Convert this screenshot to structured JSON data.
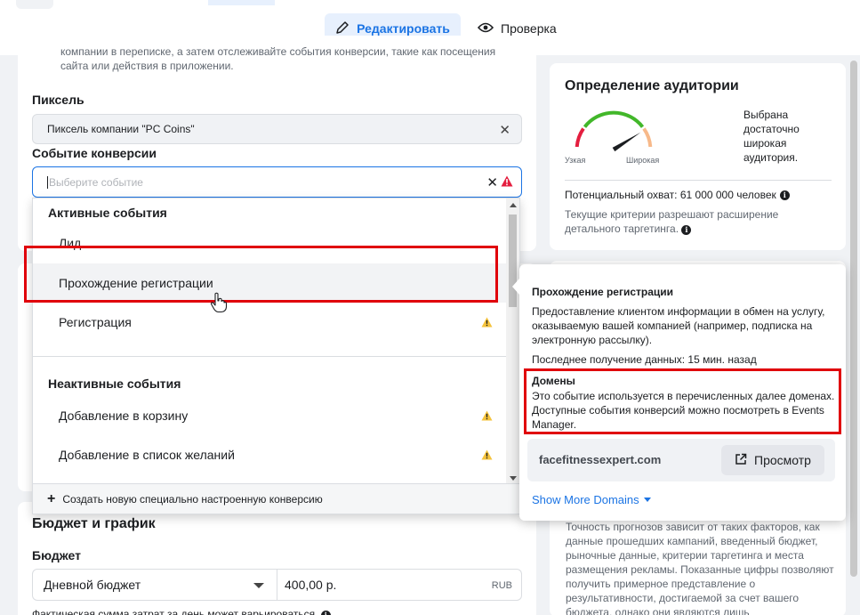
{
  "tabs": {
    "edit_label": "Редактировать",
    "review_label": "Проверка"
  },
  "conversion": {
    "intro_text": "компании в переписке, а затем отслеживайте события конверсии, такие как посещения сайта или действия в приложении.",
    "pixel_label": "Пиксель",
    "pixel_value": "Пиксель компании \"PC Coins\"",
    "event_label": "Событие конверсии",
    "event_placeholder": "Выберите событие"
  },
  "dropdown": {
    "active_header": "Активные события",
    "active_items": [
      {
        "label": "Лид",
        "warning": false
      },
      {
        "label": "Прохождение регистрации",
        "warning": false,
        "highlighted": true
      },
      {
        "label": "Регистрация",
        "warning": true
      }
    ],
    "inactive_header": "Неактивные события",
    "inactive_items": [
      {
        "label": "Добавление в корзину",
        "warning": true
      },
      {
        "label": "Добавление в список желаний",
        "warning": true
      }
    ],
    "footer_label": "Создать новую специально настроенную конверсию"
  },
  "budget": {
    "title": "Бюджет и график",
    "label": "Бюджет",
    "type_value": "Дневной бюджет",
    "amount_value": "400,00 р.",
    "currency": "RUB",
    "note": "Фактическая сумма затрат за день может варьироваться."
  },
  "audience": {
    "title": "Определение аудитории",
    "gauge_low": "Узкая",
    "gauge_high": "Широкая",
    "gauge_level": 0.82,
    "description": "Выбрана достаточно широкая аудитория.",
    "reach": "Потенциальный охват: 61 000 000 человек",
    "reach_note": "Текущие критерии разрешают расширение детального таргетинга."
  },
  "forecast_text": "Точность прогнозов зависит от таких факторов, как данные прошедших кампаний, введенный бюджет, рыночные данные, критерии таргетинга и места размещения рекламы. Показанные цифры позволяют получить примерное представление о результативности, достигаемой за счет вашего бюджета, однако они являются лишь",
  "tooltip": {
    "title": "Прохождение регистрации",
    "description": "Предоставление клиентом информации в обмен на услугу, оказываемую вашей компанией (например, подписка на электронную рассылку).",
    "last_received": "Последнее получение данных: 15 мин. назад",
    "domains_title": "Домены",
    "domains_description": "Это событие используется в перечисленных далее доменах. Доступные события конверсий можно посмотреть в Events Manager.",
    "domain": "facefitnessexpert.com",
    "view_label": "Просмотр",
    "more_label": "Show More Domains"
  },
  "colors": {
    "accent": "#1b74e4",
    "highlight_box": "#e0000b",
    "warning": "#f5c33b"
  }
}
